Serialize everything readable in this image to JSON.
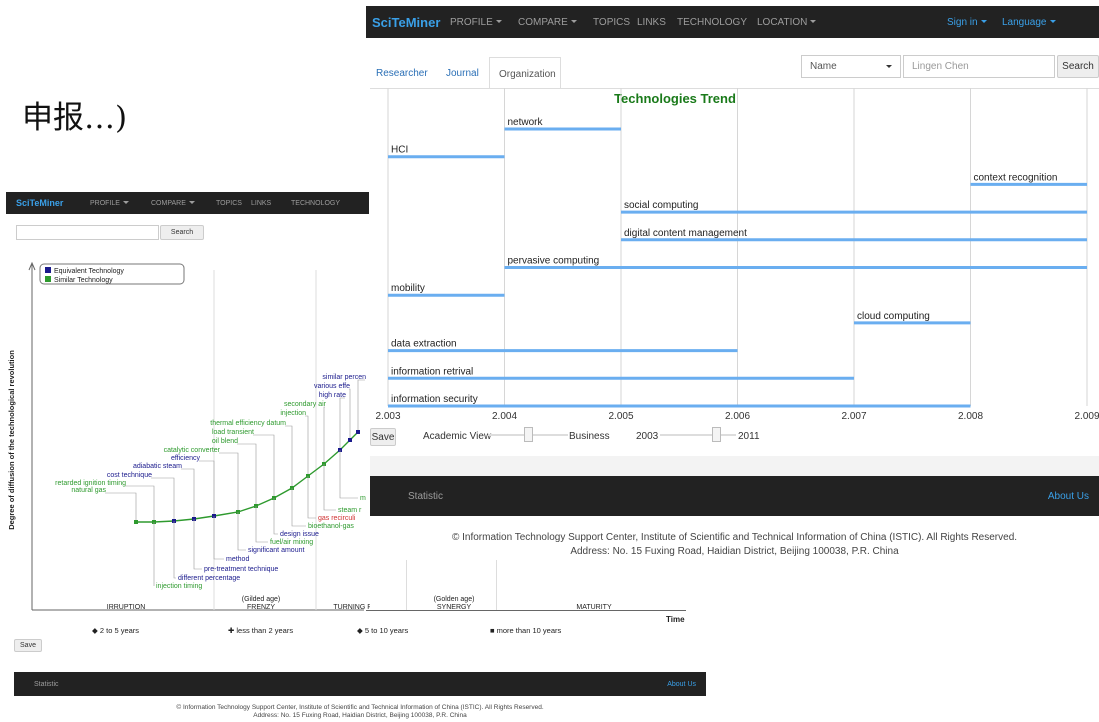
{
  "chinese_caption": "申报…)",
  "right_app": {
    "navbar": {
      "brand": "SciTeMiner",
      "items": [
        "PROFILE",
        "COMPARE",
        "TOPICS",
        "LINKS",
        "TECHNOLOGY",
        "LOCATION"
      ],
      "sign_in": "Sign in",
      "language": "Language"
    },
    "tabs": [
      "Researcher",
      "Journal",
      "Organization"
    ],
    "search": {
      "type_selected": "Name",
      "value": "Lingen Chen",
      "button": "Search"
    },
    "chart_title": "Technologies Trend",
    "controls": {
      "save": "Save",
      "academic_view": "Academic View",
      "business": "Business",
      "year_from": "2003",
      "year_to": "2011"
    },
    "footer": {
      "statistic": "Statistic",
      "about": "About Us",
      "copyright": "© Information Technology Support Center, Institute of Scientific and Technical Information of China (ISTIC). All Rights Reserved.",
      "address": "Address: No. 15 Fuxing Road, Haidian District, Beijing 100038, P.R. China"
    }
  },
  "left_app": {
    "navbar": {
      "brand": "SciTeMiner",
      "items": [
        "PROFILE",
        "COMPARE",
        "TOPICS",
        "LINKS",
        "TECHNOLOGY"
      ]
    },
    "search_button": "Search",
    "save": "Save",
    "footer": {
      "statistic": "Statistic",
      "about": "About Us",
      "copyright": "© Information Technology Support Center, Institute of Scientific and Technical Information of China (ISTIC). All Rights Reserved.",
      "address": "Address: No. 15 Fuxing Road, Haidian District, Beijing 100038, P.R. China"
    }
  },
  "chart_data": [
    {
      "type": "timeline",
      "title": "Technologies Trend",
      "x_ticks": [
        "2.003",
        "2.004",
        "2.005",
        "2.006",
        "2.007",
        "2.008",
        "2.009"
      ],
      "xlim": [
        2003,
        2009
      ],
      "bars": [
        {
          "label": "network",
          "start": 2004,
          "end": 2005
        },
        {
          "label": "HCI",
          "start": 2003,
          "end": 2004
        },
        {
          "label": "context recognition",
          "start": 2008,
          "end": 2009
        },
        {
          "label": "social computing",
          "start": 2005,
          "end": 2009
        },
        {
          "label": "digital content management",
          "start": 2005,
          "end": 2009
        },
        {
          "label": "pervasive computing",
          "start": 2004,
          "end": 2009
        },
        {
          "label": "mobility",
          "start": 2003,
          "end": 2004
        },
        {
          "label": "cloud computing",
          "start": 2007,
          "end": 2008
        },
        {
          "label": "data extraction",
          "start": 2003,
          "end": 2006
        },
        {
          "label": "information retrival",
          "start": 2003,
          "end": 2007
        },
        {
          "label": "information security",
          "start": 2003,
          "end": 2008
        }
      ],
      "color": "#6aaef0"
    },
    {
      "type": "scatter",
      "ylabel": "Degree of diffusion of the technological revolution",
      "xlabel": "Time",
      "legend": [
        {
          "name": "Equivalent Technology",
          "color": "#1a1a8c"
        },
        {
          "name": "Similar Technology",
          "color": "#2e9a2e"
        }
      ],
      "phases": [
        {
          "name": "IRRUPTION",
          "sub": ""
        },
        {
          "name": "FRENZY",
          "sub": "(Gilded age)"
        },
        {
          "name": "TURNING POINT",
          "sub": ""
        },
        {
          "name": "SYNERGY",
          "sub": "(Golden age)"
        },
        {
          "name": "MATURITY",
          "sub": ""
        }
      ],
      "duration_legend": [
        "2 to 5 years",
        "less than 2 years",
        "5 to 10 years",
        "more than 10 years"
      ],
      "labels_above": [
        {
          "text": "natural gas",
          "color": "#2e9a2e"
        },
        {
          "text": "retarded ignition timing",
          "color": "#2e9a2e"
        },
        {
          "text": "cost technique",
          "color": "#1a1a8c"
        },
        {
          "text": "adiabatic steam",
          "color": "#1a1a8c"
        },
        {
          "text": "efficiency",
          "color": "#1a1a8c"
        },
        {
          "text": "catalytic converter",
          "color": "#2e9a2e"
        },
        {
          "text": "oil blend",
          "color": "#2e9a2e"
        },
        {
          "text": "load transient",
          "color": "#2e9a2e"
        },
        {
          "text": "thermal efficiency datum",
          "color": "#2e9a2e"
        },
        {
          "text": "injection",
          "color": "#2e9a2e"
        },
        {
          "text": "secondary air",
          "color": "#2e9a2e"
        },
        {
          "text": "high rate",
          "color": "#1a1a8c"
        },
        {
          "text": "various effe",
          "color": "#1a1a8c"
        },
        {
          "text": "similar percen",
          "color": "#1a1a8c"
        }
      ],
      "labels_below": [
        {
          "text": "injection timing",
          "color": "#2e9a2e"
        },
        {
          "text": "different percentage",
          "color": "#1a1a8c"
        },
        {
          "text": "pre-treatment technique",
          "color": "#1a1a8c"
        },
        {
          "text": "method",
          "color": "#1a1a8c"
        },
        {
          "text": "significant amount",
          "color": "#1a1a8c"
        },
        {
          "text": "fuel/air mixing",
          "color": "#2e9a2e"
        },
        {
          "text": "design issue",
          "color": "#1a1a8c"
        },
        {
          "text": "bioethanol-gas",
          "color": "#2e9a2e"
        },
        {
          "text": "gas recirculi",
          "color": "#d03030"
        },
        {
          "text": "steam r",
          "color": "#2e9a2e"
        },
        {
          "text": "m",
          "color": "#2e9a2e"
        }
      ]
    }
  ]
}
